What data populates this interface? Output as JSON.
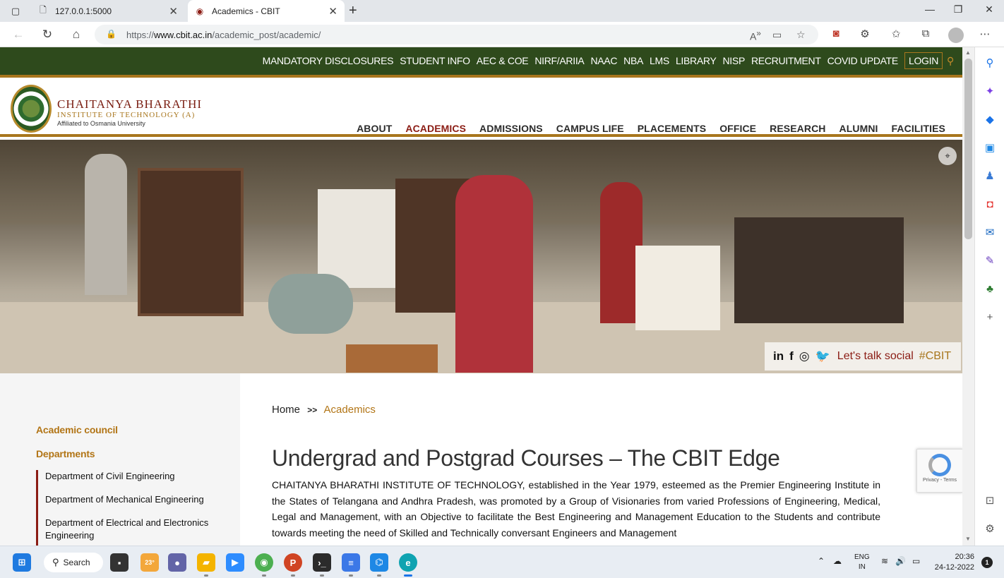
{
  "browser": {
    "tabs": [
      {
        "title": "127.0.0.1:5000",
        "active": false
      },
      {
        "title": "Academics - CBIT",
        "active": true
      }
    ],
    "url_prefix": "https://",
    "url_domain": "www.cbit.ac.in",
    "url_path": "/academic_post/academic/"
  },
  "site": {
    "topnav": [
      "MANDATORY DISCLOSURES",
      "STUDENT INFO",
      "AEC & COE",
      "NIRF/ARIIA",
      "NAAC",
      "NBA",
      "LMS",
      "LIBRARY",
      "NISP",
      "RECRUITMENT",
      "COVID UPDATE",
      "LOGIN"
    ],
    "brand_line1": "CHAITANYA BHARATHI",
    "brand_line2": "INSTITUTE OF TECHNOLOGY (A)",
    "brand_line3": "Affiliated to Osmania University",
    "mainnav": [
      "ABOUT",
      "ACADEMICS",
      "ADMISSIONS",
      "CAMPUS LIFE",
      "PLACEMENTS",
      "OFFICE",
      "RESEARCH",
      "ALUMNI",
      "FACILITIES"
    ],
    "active_nav": "ACADEMICS",
    "social_text": "Let's talk social",
    "social_tag": "#CBIT"
  },
  "sidebar": {
    "heading1": "Academic council",
    "heading2": "Departments",
    "departments": [
      "Department of Civil Engineering",
      "Department of Mechanical Engineering",
      "Department of Electrical and Electronics Engineering"
    ]
  },
  "content": {
    "crumb_home": "Home",
    "crumb_sep": ">>",
    "crumb_current": "Academics",
    "title": "Undergrad and Postgrad Courses – The CBIT Edge",
    "paragraph": "CHAITANYA BHARATHI INSTITUTE OF TECHNOLOGY, established in the Year 1979, esteemed as the Premier Engineering Institute in the States of Telangana and Andhra Pradesh, was promoted by a Group of Visionaries from varied Professions of Engineering, Medical, Legal and Management, with an Objective to facilitate the Best Engineering and Management Education to the Students and contribute towards meeting the need of Skilled and Technically conversant Engineers and Management"
  },
  "recaptcha": {
    "text": "Privacy - Terms"
  },
  "taskbar": {
    "search_label": "Search",
    "weather": "23°",
    "lang1": "ENG",
    "lang2": "IN",
    "time": "20:36",
    "date": "24-12-2022",
    "notifications": "1"
  },
  "colors": {
    "brand_green": "#2e4a1c",
    "brand_gold": "#a8761d",
    "brand_maroon": "#8b1c14"
  }
}
